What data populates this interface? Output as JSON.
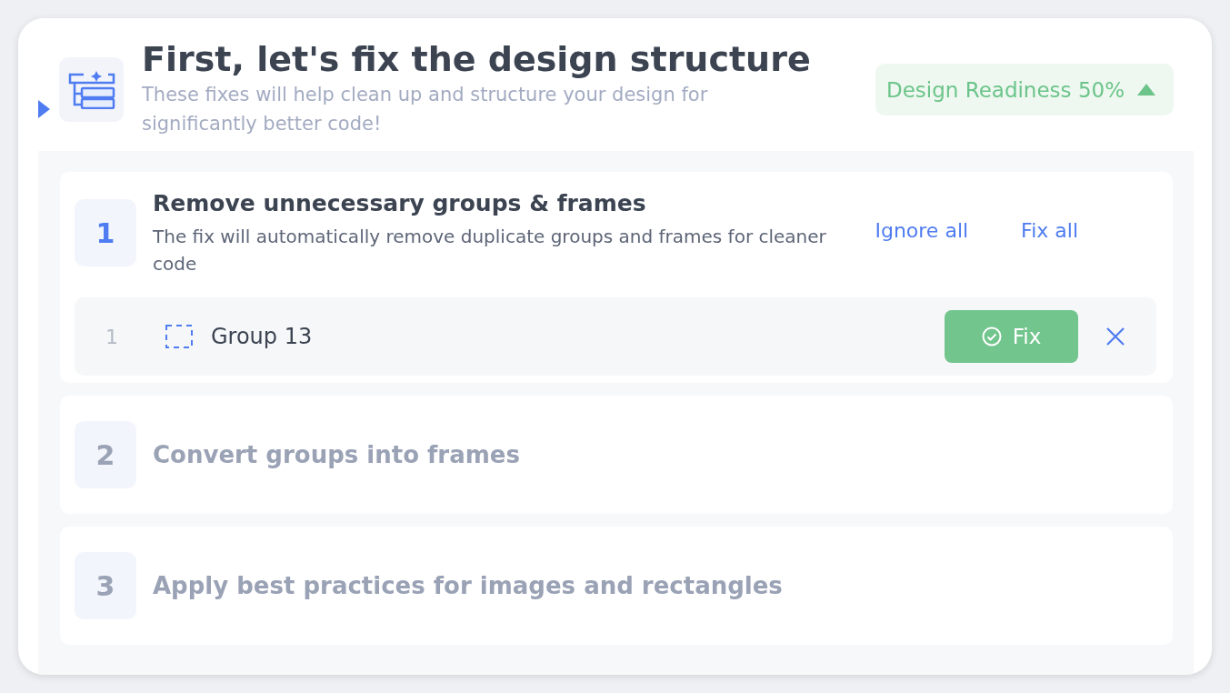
{
  "header": {
    "expanded": true,
    "title": "First, let's fix the design structure",
    "subtitle": "These fixes will help clean up and structure your design for significantly better code!",
    "readiness": {
      "label": "Design Readiness 50%",
      "expanded": true
    }
  },
  "steps": [
    {
      "number": "1",
      "title": "Remove unnecessary groups & frames",
      "description": "The fix will automatically remove duplicate groups and frames for cleaner code",
      "expanded": true,
      "actions": [
        "Ignore all",
        "Fix all"
      ],
      "items": [
        {
          "index": "1",
          "name": "Group 13",
          "fix_label": "Fix"
        }
      ]
    },
    {
      "number": "2",
      "title": "Convert groups into frames",
      "expanded": false
    },
    {
      "number": "3",
      "title": "Apply best practices for images and rectangles",
      "expanded": false
    }
  ]
}
